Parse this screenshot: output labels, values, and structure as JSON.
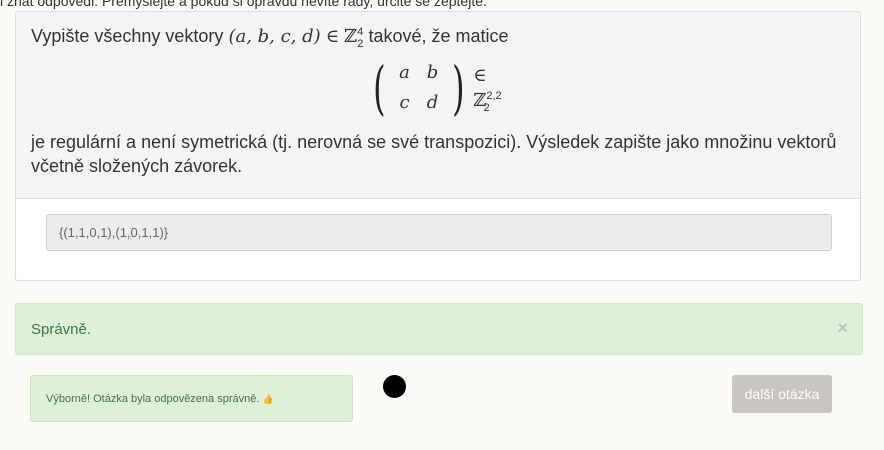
{
  "top_clip": "i znát odpovědi. Přemýšlejte a pokud si opravdu nevíte rady, určitě se zeptejte.",
  "question": {
    "prefix": "Vypište všechny vektory",
    "vector": "(a, b, c, d)",
    "in": "∈",
    "field_base": "ℤ",
    "field_sup": "4",
    "field_sub": "2",
    "suffix": "takové, že matice",
    "matrix": [
      "a",
      "b",
      "c",
      "d"
    ],
    "matrix_in": "∈",
    "matrix_space_base": "ℤ",
    "matrix_space_sup": "2,2",
    "matrix_space_sub": "2",
    "body": "je regulární a není symetrická (tj. nerovná se své transpozici). Výsledek zapište jako množinu vektorů včetně složených závorek."
  },
  "answer": {
    "value": "{(1,1,0,1),(1,0,1,1)}"
  },
  "result": {
    "message": "Správně.",
    "close_glyph": "×"
  },
  "feedback": {
    "text": "Výborně! Otázka byla odpovězena správně.",
    "icon": "thumbs-up-icon",
    "icon_glyph": "👍"
  },
  "next_button": {
    "label": "další otázka"
  },
  "colors": {
    "success_bg": "#dff0d8",
    "success_text": "#3c763d",
    "button_bg": "#c9c5c1"
  }
}
